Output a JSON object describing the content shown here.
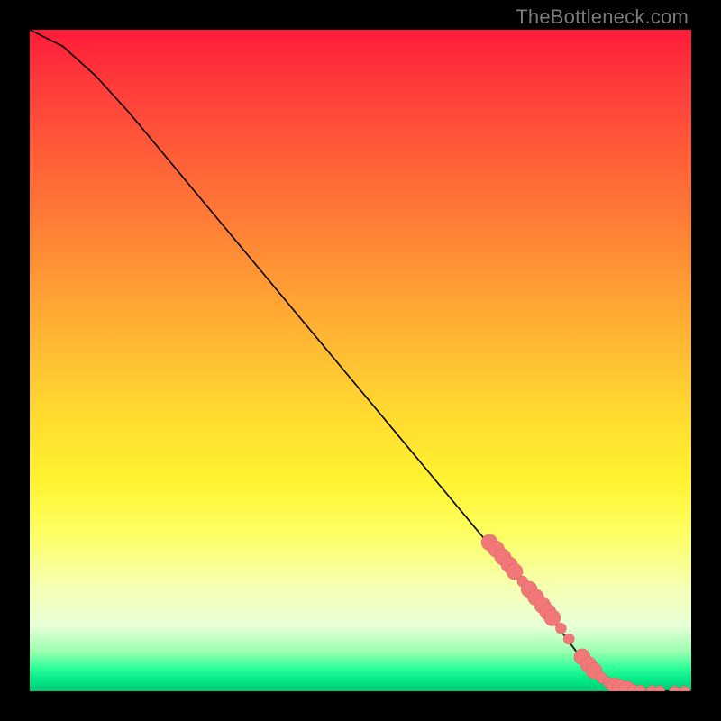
{
  "attribution": "TheBottleneck.com",
  "chart_data": {
    "type": "line",
    "title": "",
    "xlabel": "",
    "ylabel": "",
    "xlim": [
      0,
      100
    ],
    "ylim": [
      0,
      100
    ],
    "grid": false,
    "legend": false,
    "series": [
      {
        "name": "curve",
        "x": [
          0,
          2,
          5,
          10,
          15,
          20,
          25,
          30,
          35,
          40,
          45,
          50,
          55,
          60,
          65,
          70,
          75,
          80,
          83,
          86,
          88,
          90,
          92,
          94,
          96,
          98,
          100
        ],
        "y": [
          100,
          99,
          97.5,
          93,
          87.5,
          81.5,
          75.5,
          69.5,
          63.5,
          57.5,
          51.5,
          45.5,
          39.5,
          33.5,
          27.5,
          21.5,
          15.5,
          9.5,
          5.5,
          2.2,
          0.9,
          0.3,
          0.1,
          0.05,
          0.02,
          0.0,
          0.0
        ]
      }
    ],
    "markers": {
      "name": "highlight-points",
      "color": "#f07878",
      "radius_large": 9,
      "radius_small": 6,
      "points": [
        {
          "x": 69.5,
          "y": 22.5,
          "r": 9
        },
        {
          "x": 70.5,
          "y": 21.5,
          "r": 9
        },
        {
          "x": 71.5,
          "y": 20.3,
          "r": 9
        },
        {
          "x": 72.5,
          "y": 19.1,
          "r": 9
        },
        {
          "x": 73.3,
          "y": 18.1,
          "r": 9
        },
        {
          "x": 74.5,
          "y": 16.6,
          "r": 6
        },
        {
          "x": 75.5,
          "y": 15.4,
          "r": 9
        },
        {
          "x": 76.5,
          "y": 14.2,
          "r": 9
        },
        {
          "x": 77.5,
          "y": 13.0,
          "r": 9
        },
        {
          "x": 78.3,
          "y": 12.0,
          "r": 9
        },
        {
          "x": 79.0,
          "y": 11.1,
          "r": 9
        },
        {
          "x": 80.3,
          "y": 9.5,
          "r": 6
        },
        {
          "x": 81.5,
          "y": 7.9,
          "r": 6
        },
        {
          "x": 83.5,
          "y": 5.2,
          "r": 9
        },
        {
          "x": 84.5,
          "y": 4.0,
          "r": 9
        },
        {
          "x": 85.3,
          "y": 3.1,
          "r": 9
        },
        {
          "x": 86.5,
          "y": 2.0,
          "r": 6
        },
        {
          "x": 87.5,
          "y": 1.3,
          "r": 6
        },
        {
          "x": 88.5,
          "y": 0.8,
          "r": 9
        },
        {
          "x": 89.3,
          "y": 0.5,
          "r": 9
        },
        {
          "x": 90.3,
          "y": 0.3,
          "r": 9
        },
        {
          "x": 91.2,
          "y": 0.2,
          "r": 6
        },
        {
          "x": 92.3,
          "y": 0.12,
          "r": 6
        },
        {
          "x": 94.0,
          "y": 0.05,
          "r": 6
        },
        {
          "x": 95.2,
          "y": 0.03,
          "r": 6
        },
        {
          "x": 97.5,
          "y": 0.0,
          "r": 6
        },
        {
          "x": 99.0,
          "y": 0.0,
          "r": 6
        }
      ]
    }
  }
}
